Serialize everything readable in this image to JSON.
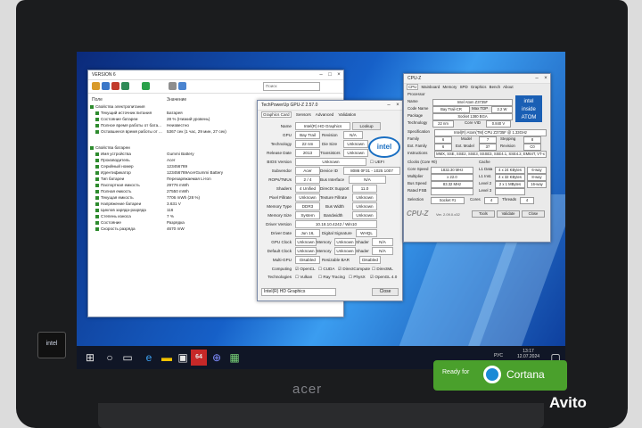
{
  "aida": {
    "title": "VERSION 6",
    "search_placeholder": "Поиск",
    "col_field": "Поле",
    "col_value": "Значение",
    "rows": [
      {
        "label": "Свойства электропитания",
        "value": ""
      },
      {
        "label": "Текущий источник питания",
        "value": "Батарея"
      },
      {
        "label": "Состояние батареи",
        "value": "28 % (Низкий уровень)"
      },
      {
        "label": "Полное время работы от бата...",
        "value": "Неизвестно"
      },
      {
        "label": "Оставшееся время работы от ...",
        "value": "5367 сек (1 час, 29 мин, 27 сек)"
      },
      {
        "label": "",
        "value": ""
      },
      {
        "label": "Свойства батареи",
        "value": ""
      },
      {
        "label": "Имя устройства",
        "value": "Gummi Battery"
      },
      {
        "label": "Производитель",
        "value": "Acer"
      },
      {
        "label": "Серийный номер",
        "value": "123456789"
      },
      {
        "label": "Идентификатор",
        "value": "123456789AcerGummi Battery"
      },
      {
        "label": "Тип батареи",
        "value": "Перезаряжаемая Li-Ion"
      },
      {
        "label": "Паспортная емкость",
        "value": "29776 mWh"
      },
      {
        "label": "Полная емкость",
        "value": "27550 mWh"
      },
      {
        "label": "Текущая емкость",
        "value": "7706 mWh (28 %)"
      },
      {
        "label": "Напряжение батареи",
        "value": "3.631 V"
      },
      {
        "label": "Циклов заряда-разряда",
        "value": "116"
      },
      {
        "label": "Степень износа",
        "value": "7 %"
      },
      {
        "label": "Состояние",
        "value": "Разрядка"
      },
      {
        "label": "Скорость разряда",
        "value": "4670 mW"
      }
    ]
  },
  "gpuz": {
    "title": "TechPowerUp GPU-Z 2.57.0",
    "tabs": [
      "Graphics Card",
      "Sensors",
      "Advanced",
      "Validation"
    ],
    "name_label": "Name",
    "name": "Intel(R) HD Graphics",
    "lookup": "Lookup",
    "gpu_label": "GPU",
    "gpu": "Bay Trail",
    "revision_label": "Revision",
    "revision": "N/A",
    "tech_label": "Technology",
    "tech": "22 nm",
    "die_label": "Die Size",
    "die": "Unknown",
    "release_label": "Release Date",
    "release": "2013",
    "trans_label": "Transistors",
    "trans": "Unknown",
    "bios_label": "BIOS Version",
    "bios": "Unknown",
    "uefi": "UEFI",
    "subvendor_label": "Subvendor",
    "subvendor": "Acer",
    "device_label": "Device ID",
    "device": "8086 0F31 - 1025 1007",
    "rops_label": "ROPs/TMUs",
    "rops": "2 / 4",
    "bus_label": "Bus Interface",
    "bus": "N/A",
    "shaders_label": "Shaders",
    "shaders": "4 Unified",
    "dx_label": "DirectX Support",
    "dx": "11.0",
    "pixel_label": "Pixel Fillrate",
    "pixel": "Unknown",
    "texture_label": "Texture Fillrate",
    "texture": "Unknown",
    "memtype_label": "Memory Type",
    "memtype": "DDR3",
    "buswidth_label": "Bus Width",
    "buswidth": "Unknown",
    "memsize_label": "Memory Size",
    "memsize": "System Shared",
    "bandwidth_label": "Bandwidth",
    "bandwidth": "Unknown",
    "driver_label": "Driver Version",
    "driver": "10.18.10.4242 / Win10",
    "driverdate_label": "Driver Date",
    "driverdate": "Jun 16, 2015",
    "digsig_label": "Digital Signature",
    "digsig": "WHQL",
    "gpuclock_label": "GPU Clock",
    "gpuclock": "Unknown",
    "mem1_label": "Memory",
    "mem1": "Unknown",
    "shader1_label": "Shader",
    "shader1": "N/A",
    "defclock_label": "Default Clock",
    "defclock": "Unknown",
    "mem2_label": "Memory",
    "mem2": "Unknown",
    "shader2_label": "Shader",
    "shader2": "N/A",
    "multigpu_label": "Multi-GPU",
    "multigpu": "Disabled",
    "rebar_label": "Resizable BAR",
    "rebar": "Disabled",
    "computing_label": "Computing",
    "opencl": "OpenCL",
    "cuda": "CUDA",
    "directcompute": "DirectCompute",
    "directml": "DirectML",
    "tech2_label": "Technologies",
    "vulkan": "Vulkan",
    "raytracing": "Ray Tracing",
    "physx": "PhysX",
    "opengl": "OpenGL 4.0",
    "select": "Intel(R) HD Graphics",
    "close": "Close"
  },
  "cpuz": {
    "title": "CPU-Z",
    "tabs": [
      "CPU",
      "Mainboard",
      "Memory",
      "SPD",
      "Graphics",
      "Bench",
      "About"
    ],
    "processor_label": "Processor",
    "name_label": "Name",
    "name": "Intel Atom Z3735F",
    "codename_label": "Code Name",
    "codename": "Bay Trail-CR",
    "maxtdp_label": "Max TDP",
    "maxtdp": "2.2 W",
    "package_label": "Package",
    "package": "Socket 1380 BGA",
    "technology_label": "Technology",
    "technology": "22 nm",
    "corevid_label": "Core VID",
    "corevid": "0.840 V",
    "spec_label": "Specification",
    "spec": "Intel(R) Atom(TM) CPU Z3735F @ 1.33GHz",
    "family_label": "Family",
    "family": "6",
    "model_label": "Model",
    "model": "7",
    "stepping_label": "Stepping",
    "stepping": "8",
    "extfam_label": "Ext. Family",
    "extfam": "6",
    "extmodel_label": "Ext. Model",
    "extmodel": "37",
    "revision_label": "Revision",
    "revision": "C0",
    "instr_label": "Instructions",
    "instr": "MMX, SSE, SSE2, SSE3, SSSE3, SSE4.1, SSE4.2, EM64T, VT-x",
    "clocks_label": "Clocks (Core #0)",
    "cache_label": "Cache",
    "corespeed_label": "Core Speed",
    "corespeed": "1832.30 MHz",
    "l1d_label": "L1 Data",
    "l1d": "4 x 24 KBytes",
    "l1d_way": "6-way",
    "mult_label": "Multiplier",
    "mult": "x 22.0",
    "l1i_label": "L1 Inst.",
    "l1i": "4 x 32 KBytes",
    "l1i_way": "8-way",
    "busspeed_label": "Bus Speed",
    "busspeed": "83.32 MHz",
    "l2_label": "Level 2",
    "l2": "2 x 1 MBytes",
    "l2_way": "16-way",
    "ratedfsb_label": "Rated FSB",
    "level3_label": "Level 3",
    "selection_label": "Selection",
    "selection": "Socket #1",
    "cores_label": "Cores",
    "cores": "4",
    "threads_label": "Threads",
    "threads": "4",
    "version": "Ver. 2.09.0.x32",
    "tools": "Tools",
    "validate": "Validate",
    "close": "Close",
    "logo_top": "intel",
    "logo_bottom": "inside ATOM"
  },
  "taskbar": {
    "time": "13:17",
    "date": "12.07.2024",
    "lang": "РУС",
    "app_badge": "64"
  },
  "brand": {
    "acer": "acer",
    "sticker": "intel",
    "cortana_ready": "Ready for",
    "cortana": "Cortana",
    "avito": "Avito"
  }
}
